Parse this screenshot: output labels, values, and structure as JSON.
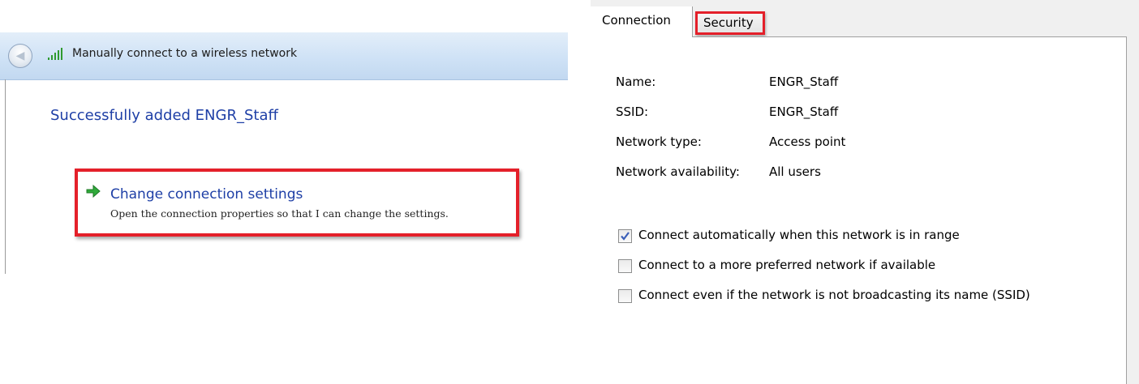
{
  "wizard": {
    "title": "Manually connect to a wireless network",
    "back_icon": "back-arrow-icon",
    "network_icon": "wireless-signal-icon",
    "success_heading": "Successfully added ENGR_Staff",
    "command_link": {
      "icon": "green-arrow-icon",
      "title": "Change connection settings",
      "description": "Open the connection properties so that I can change the settings."
    },
    "highlight_color": "#e4202a",
    "heading_color": "#1e3fa6"
  },
  "properties": {
    "tabs": [
      {
        "label": "Connection",
        "selected": true
      },
      {
        "label": "Security",
        "selected": false
      }
    ],
    "info": [
      {
        "label": "Name:",
        "value": "ENGR_Staff"
      },
      {
        "label": "SSID:",
        "value": "ENGR_Staff"
      },
      {
        "label": "Network type:",
        "value": "Access point"
      },
      {
        "label": "Network availability:",
        "value": "All users"
      }
    ],
    "options": [
      {
        "label": "Connect automatically when this network is in range",
        "checked": true
      },
      {
        "label": "Connect to a more preferred network if available",
        "checked": false
      },
      {
        "label": "Connect even if the network is not broadcasting its name (SSID)",
        "checked": false
      }
    ]
  }
}
